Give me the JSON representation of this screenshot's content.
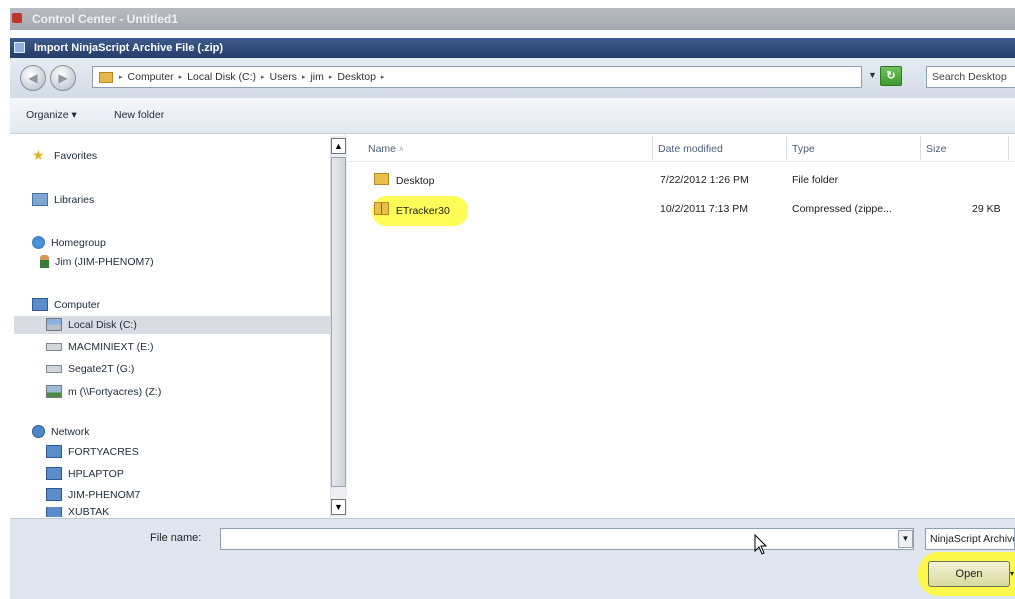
{
  "outer_window": {
    "title": "Control Center - Untitled1"
  },
  "dialog": {
    "title": "Import NinjaScript Archive File (.zip)"
  },
  "address_bar": {
    "breadcrumbs": [
      "Computer",
      "Local Disk (C:)",
      "Users",
      "jim",
      "Desktop"
    ],
    "search_placeholder": "Search Desktop"
  },
  "toolbar": {
    "organize_label": "Organize ▾",
    "new_folder_label": "New folder"
  },
  "nav": {
    "favorites": "Favorites",
    "libraries": "Libraries",
    "homegroup": "Homegroup",
    "homegroup_user": "Jim (JIM-PHENOM7)",
    "computer": "Computer",
    "drives": [
      "Local Disk (C:)",
      "MACMINIEXT (E:)",
      "Segate2T (G:)",
      "m (\\\\Fortyacres) (Z:)"
    ],
    "network": "Network",
    "network_items": [
      "FORTYACRES",
      "HPLAPTOP",
      "JIM-PHENOM7",
      "XUBTAK"
    ]
  },
  "file_list": {
    "columns": [
      "Name",
      "Date modified",
      "Type",
      "Size"
    ],
    "rows": [
      {
        "name": "Desktop",
        "date": "7/22/2012 1:26 PM",
        "type": "File folder",
        "size": ""
      },
      {
        "name": "ETracker30",
        "date": "10/2/2011 7:13 PM",
        "type": "Compressed (zippe...",
        "size": "29 KB"
      }
    ]
  },
  "footer": {
    "file_name_label": "File name:",
    "file_name_value": "",
    "file_type_value": "NinjaScript Archive",
    "open_label": "Open"
  },
  "colors": {
    "highlight": "#fffb3a",
    "title_bar": "#243e6b"
  },
  "icons": [
    "back-icon",
    "forward-icon",
    "folder-icon",
    "refresh-icon",
    "star-icon",
    "library-icon",
    "homegroup-icon",
    "user-icon",
    "computer-icon",
    "drive-icon",
    "network-drive-icon",
    "network-icon",
    "zip-folder-icon",
    "cursor-icon"
  ]
}
